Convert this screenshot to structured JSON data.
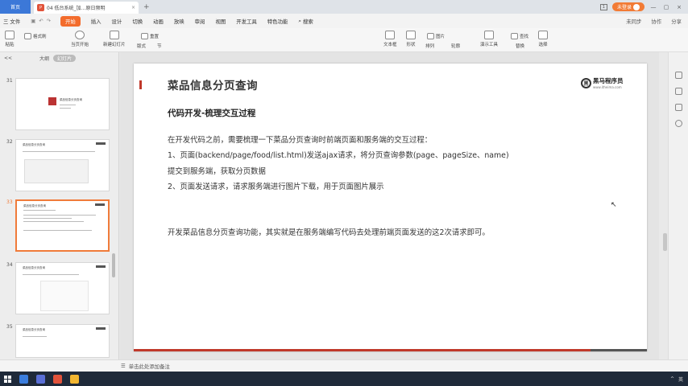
{
  "titlebar": {
    "home_tab": "首页",
    "doc_title": "04 低台系统_加…原日频明",
    "tab_close": "×",
    "add_tab": "+",
    "badge": "1",
    "login": "未登录",
    "min": "—",
    "max": "▢",
    "close": "×"
  },
  "menubar": {
    "file": "三 文件",
    "tabs": [
      "开始",
      "插入",
      "设计",
      "切换",
      "动画",
      "放映",
      "审阅",
      "视图",
      "开发工具",
      "特色功能"
    ],
    "search": "搜索",
    "sync": "未同步",
    "collab": "协作",
    "share": "分享"
  },
  "ribbon": {
    "paste": "粘贴",
    "format_painter": "格式刷",
    "from_current": "当页开始",
    "new_slide": "新建幻灯片",
    "layout": "版式",
    "section": "节",
    "reset": "重置",
    "font_size": "0",
    "textbox": "文本框",
    "shape": "形状",
    "arrange": "排列",
    "picture": "图片",
    "outline": "轮廓",
    "present_tools": "演示工具",
    "replace": "替换",
    "find": "查找",
    "select": "选择"
  },
  "leftpanel": {
    "collapse": "<<",
    "outline_view": "大纲",
    "slides_view": "幻灯片",
    "slides": [
      {
        "num": "31",
        "title": "菜品信息分页查询"
      },
      {
        "num": "32",
        "title": "菜品信息分页查询"
      },
      {
        "num": "33",
        "title": "菜品信息分页查询"
      },
      {
        "num": "34",
        "title": "菜品信息分页查询"
      },
      {
        "num": "35",
        "title": "菜品信息分页查询"
      }
    ],
    "add": "+"
  },
  "slide": {
    "title": "菜品信息分页查询",
    "logo_mark": "黑",
    "logo_name": "黑马程序员",
    "logo_url": "www.itheima.com",
    "subtitle": "代码开发-梳理交互过程",
    "para1": "在开发代码之前，需要梳理一下菜品分页查询时前端页面和服务端的交互过程：",
    "para2": "1、页面(backend/page/food/list.html)发送ajax请求，将分页查询参数(page、pageSize、name)",
    "para3": "提交到服务端，获取分页数据",
    "para4": "2、页面发送请求，请求服务端进行图片下载，用于页面图片展示",
    "para5": "开发菜品信息分页查询功能，其实就是在服务端编写代码去处理前端页面发送的这2次请求即可。"
  },
  "statusbar": {
    "note": "单击此处添加备注"
  },
  "taskbar": {
    "lang": "英"
  }
}
